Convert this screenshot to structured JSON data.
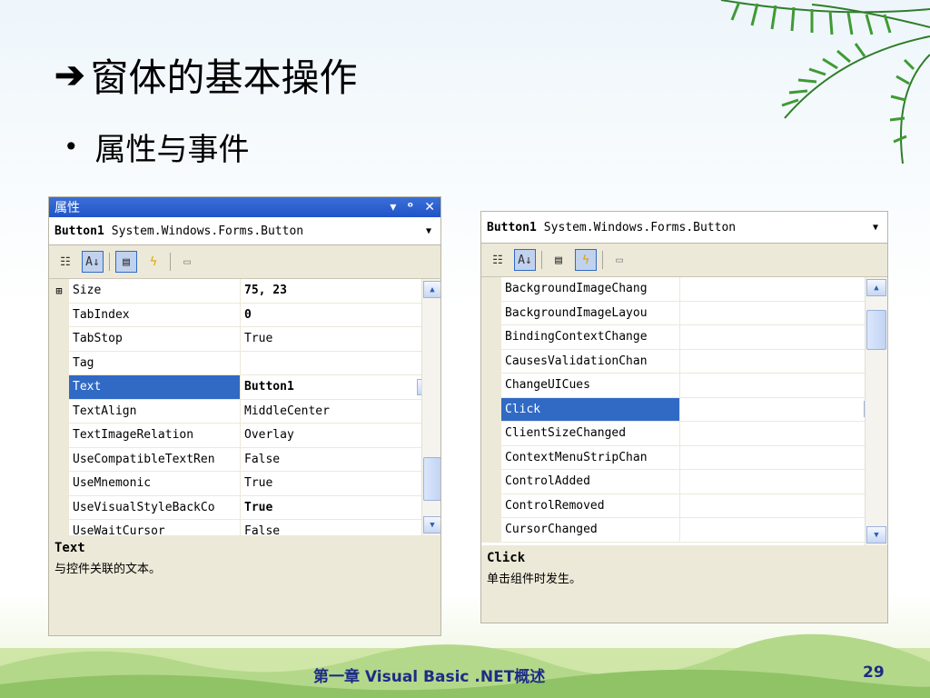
{
  "slide": {
    "title_arrow": "➔",
    "title": "窗体的基本操作",
    "bullet": "属性与事件",
    "footer_text": "第一章 Visual Basic .NET概述",
    "page_number": "29"
  },
  "properties_panel": {
    "window_title": "属性",
    "window_icons": [
      "▾",
      "ᵒ",
      "✕"
    ],
    "object_name": "Button1",
    "object_type": "System.Windows.Forms.Button",
    "rows": [
      {
        "expander": "⊞",
        "name": "Size",
        "value": "75, 23",
        "bold": true
      },
      {
        "expander": "",
        "name": "TabIndex",
        "value": "0",
        "bold": true
      },
      {
        "expander": "",
        "name": "TabStop",
        "value": "True",
        "bold": false
      },
      {
        "expander": "",
        "name": "Tag",
        "value": "",
        "bold": false
      },
      {
        "expander": "",
        "name": "Text",
        "value": "Button1",
        "bold": true,
        "selected": true
      },
      {
        "expander": "",
        "name": "TextAlign",
        "value": "MiddleCenter",
        "bold": false
      },
      {
        "expander": "",
        "name": "TextImageRelation",
        "value": "Overlay",
        "bold": false
      },
      {
        "expander": "",
        "name": "UseCompatibleTextRen",
        "value": "False",
        "bold": false
      },
      {
        "expander": "",
        "name": "UseMnemonic",
        "value": "True",
        "bold": false
      },
      {
        "expander": "",
        "name": "UseVisualStyleBackCo",
        "value": "True",
        "bold": true
      },
      {
        "expander": "",
        "name": "UseWaitCursor",
        "value": "False",
        "bold": false
      }
    ],
    "desc_title": "Text",
    "desc_text": "与控件关联的文本。"
  },
  "events_panel": {
    "object_name": "Button1",
    "object_type": "System.Windows.Forms.Button",
    "rows": [
      {
        "name": "BackgroundImageChang",
        "value": ""
      },
      {
        "name": "BackgroundImageLayou",
        "value": ""
      },
      {
        "name": "BindingContextChange",
        "value": ""
      },
      {
        "name": "CausesValidationChan",
        "value": ""
      },
      {
        "name": "ChangeUICues",
        "value": ""
      },
      {
        "name": "Click",
        "value": "",
        "selected": true
      },
      {
        "name": "ClientSizeChanged",
        "value": ""
      },
      {
        "name": "ContextMenuStripChan",
        "value": ""
      },
      {
        "name": "ControlAdded",
        "value": ""
      },
      {
        "name": "ControlRemoved",
        "value": ""
      },
      {
        "name": "CursorChanged",
        "value": ""
      }
    ],
    "desc_title": "Click",
    "desc_text": "单击组件时发生。"
  },
  "colors": {
    "selection": "#316ac5",
    "titlebar": "#1f54c9",
    "footer_text": "#1d2c86"
  }
}
